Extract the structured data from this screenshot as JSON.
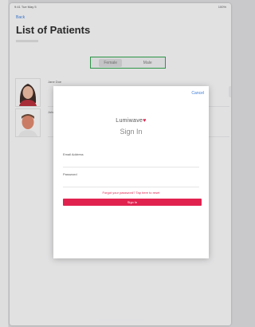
{
  "statusbar": {
    "time": "9:41 Tue May 5",
    "battery": "100%"
  },
  "nav": {
    "back_label": "Back"
  },
  "page": {
    "title": "List of Patients"
  },
  "segments": {
    "first": "Female",
    "second": "Male"
  },
  "patients": [
    {
      "name": "Jane Doe"
    },
    {
      "name": "John"
    }
  ],
  "modal": {
    "close_label": "Cancel",
    "brand_name": "Lumiwave",
    "brand_mark": "♥",
    "title": "Sign In",
    "email_label": "Email Address",
    "email_value": "",
    "password_label": "Password",
    "password_value": "",
    "forgot_label": "Forgot your password? Tap here to reset",
    "signin_label": "Sign In"
  },
  "colors": {
    "accent": "#e0224f",
    "link": "#3a7ad6",
    "highlight": "#2fa04a"
  }
}
